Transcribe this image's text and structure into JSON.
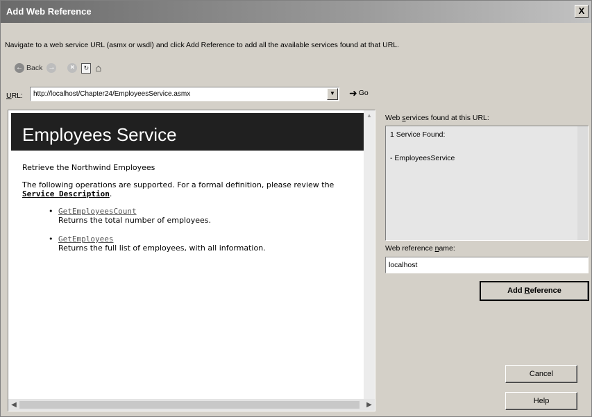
{
  "window": {
    "title": "Add Web Reference",
    "close_glyph": "X"
  },
  "instructions": "Navigate to a web service URL (asmx or wsdl) and click Add Reference to add all the available services found at that URL.",
  "toolbar": {
    "back_label": "Back",
    "icons": [
      "back-icon",
      "forward-icon",
      "stop-icon",
      "refresh-icon",
      "home-icon"
    ]
  },
  "url": {
    "label_pre": "",
    "label_ul": "U",
    "label_post": "RL:",
    "value": "http://localhost/Chapter24/EmployeesService.asmx",
    "go_label": "Go"
  },
  "browser": {
    "service_title": "Employees Service",
    "description": "Retrieve the Northwind Employees",
    "ops_intro": "The following operations are supported. For a formal definition, please review the ",
    "service_description_link": "Service Description",
    "ops_intro_end": ".",
    "operations": [
      {
        "name": "GetEmployeesCount",
        "desc": "Returns the total number of employees."
      },
      {
        "name": "GetEmployees",
        "desc": "Returns the full list of employees, with all information."
      }
    ]
  },
  "found": {
    "label_pre": "Web ",
    "label_ul": "s",
    "label_post": "ervices found at this URL:",
    "count_text": "1 Service Found:",
    "service_item": "- EmployeesService"
  },
  "reference_name": {
    "label_pre": "Web reference ",
    "label_ul": "n",
    "label_post": "ame:",
    "value": "localhost"
  },
  "buttons": {
    "add_pre": "Add ",
    "add_ul": "R",
    "add_post": "eference",
    "cancel": "Cancel",
    "help": "Help"
  }
}
